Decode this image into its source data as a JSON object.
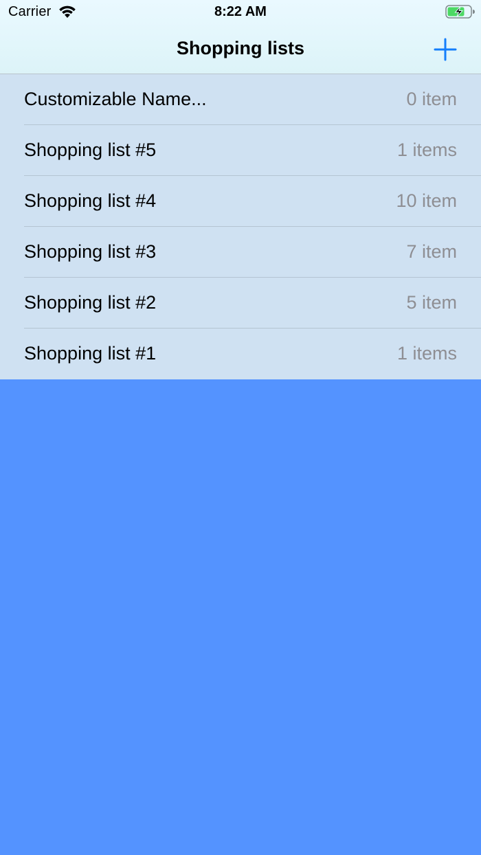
{
  "status_bar": {
    "carrier": "Carrier",
    "time": "8:22 AM",
    "wifi_icon": "wifi-icon",
    "battery_icon": "battery-charging-icon"
  },
  "nav": {
    "title": "Shopping lists",
    "add_icon": "plus-icon",
    "accent_color": "#147EFB"
  },
  "colors": {
    "list_background": "#CFE1F2",
    "page_background": "#5493FF",
    "secondary_text": "#8E8E93"
  },
  "lists": [
    {
      "name": "Customizable Name...",
      "count": "0 item"
    },
    {
      "name": "Shopping list #5",
      "count": "1 items"
    },
    {
      "name": "Shopping list #4",
      "count": "10 item"
    },
    {
      "name": "Shopping list #3",
      "count": "7 item"
    },
    {
      "name": "Shopping list #2",
      "count": "5 item"
    },
    {
      "name": "Shopping list #1",
      "count": "1 items"
    }
  ]
}
